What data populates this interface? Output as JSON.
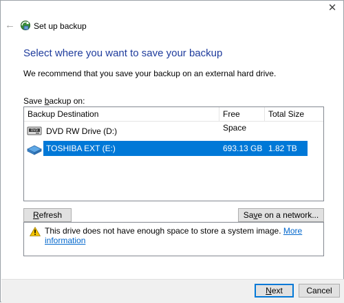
{
  "window": {
    "close_glyph": "✕",
    "back_glyph": "←",
    "title": "Set up backup"
  },
  "page": {
    "heading": "Select where you want to save your backup",
    "recommendation": "We recommend that you save your backup on an external hard drive.",
    "save_label_prefix": "Save ",
    "save_label_accel": "b",
    "save_label_suffix": "ackup on:"
  },
  "list": {
    "columns": [
      "Backup Destination",
      "Free Space",
      "Total Size"
    ],
    "rows": [
      {
        "name": "DVD RW Drive (D:)",
        "free": "",
        "total": "",
        "icon": "dvd-drive-icon",
        "selected": false
      },
      {
        "name": "TOSHIBA EXT (E:)",
        "free": "693.13 GB",
        "total": "1.82 TB",
        "icon": "external-drive-icon",
        "selected": true
      }
    ]
  },
  "buttons": {
    "refresh_accel": "R",
    "refresh_rest": "efresh",
    "network_pre": "Sa",
    "network_accel": "v",
    "network_post": "e on a network...",
    "next_accel": "N",
    "next_rest": "ext",
    "cancel": "Cancel"
  },
  "message": {
    "text": "This drive does not have enough space to store a system image.",
    "link": "More information"
  },
  "colors": {
    "heading": "#1e3b9c",
    "selection": "#0078d7",
    "link": "#0066cc"
  }
}
